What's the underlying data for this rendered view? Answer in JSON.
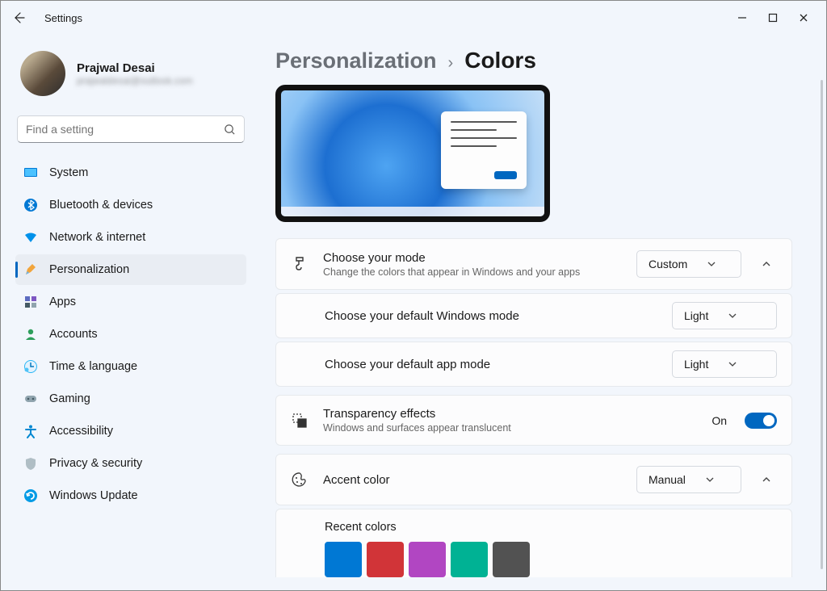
{
  "window": {
    "title": "Settings"
  },
  "user": {
    "name": "Prajwal Desai",
    "email": "prajwaldesai@outlook.com"
  },
  "search": {
    "placeholder": "Find a setting"
  },
  "sidebar": {
    "items": [
      {
        "label": "System"
      },
      {
        "label": "Bluetooth & devices"
      },
      {
        "label": "Network & internet"
      },
      {
        "label": "Personalization"
      },
      {
        "label": "Apps"
      },
      {
        "label": "Accounts"
      },
      {
        "label": "Time & language"
      },
      {
        "label": "Gaming"
      },
      {
        "label": "Accessibility"
      },
      {
        "label": "Privacy & security"
      },
      {
        "label": "Windows Update"
      }
    ],
    "active_index": 3
  },
  "breadcrumb": {
    "parent": "Personalization",
    "current": "Colors"
  },
  "mode": {
    "title": "Choose your mode",
    "desc": "Change the colors that appear in Windows and your apps",
    "value": "Custom",
    "windows_mode_label": "Choose your default Windows mode",
    "windows_mode_value": "Light",
    "app_mode_label": "Choose your default app mode",
    "app_mode_value": "Light"
  },
  "transparency": {
    "title": "Transparency effects",
    "desc": "Windows and surfaces appear translucent",
    "state_label": "On"
  },
  "accent": {
    "title": "Accent color",
    "value": "Manual",
    "recent_label": "Recent colors",
    "recent_colors": [
      "#0078d4",
      "#d13438",
      "#b146c2",
      "#00b294",
      "#525252"
    ]
  }
}
